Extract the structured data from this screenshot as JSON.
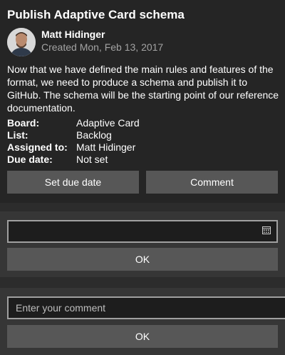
{
  "card": {
    "title": "Publish Adaptive Card schema",
    "author": {
      "name": "Matt Hidinger",
      "created": "Created Mon, Feb 13, 2017"
    },
    "description": "Now that we have defined the main rules and features of the format, we need to produce a schema and publish it to GitHub. The schema will be the starting point of our reference documentation.",
    "facts": [
      {
        "title": "Board:",
        "value": "Adaptive Card"
      },
      {
        "title": "List:",
        "value": "Backlog"
      },
      {
        "title": "Assigned to:",
        "value": "Matt Hidinger"
      },
      {
        "title": "Due date:",
        "value": "Not set"
      }
    ],
    "actions": {
      "set_due_date": "Set due date",
      "comment": "Comment"
    }
  },
  "due_date_panel": {
    "date_value": "",
    "ok_label": "OK"
  },
  "comment_panel": {
    "placeholder": "Enter your comment",
    "ok_label": "OK"
  },
  "colors": {
    "background": "#1f1f1f",
    "card": "#252525",
    "panel": "#363636",
    "button": "#575757",
    "secondary_text": "#a3a3a3"
  }
}
